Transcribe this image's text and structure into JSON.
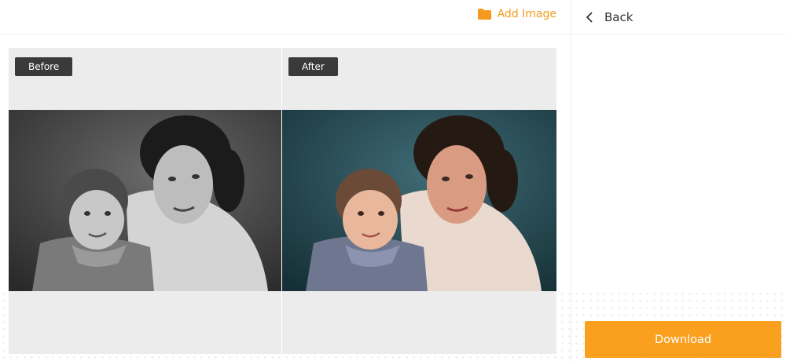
{
  "toolbar": {
    "add_image_label": "Add Image",
    "add_image_icon": "folder-icon",
    "accent_color": "#f39a1c"
  },
  "right_panel": {
    "back_label": "Back",
    "back_icon": "chevron-left-icon",
    "download_label": "Download",
    "download_color": "#fb9f1f"
  },
  "compare": {
    "before_label": "Before",
    "after_label": "After"
  }
}
